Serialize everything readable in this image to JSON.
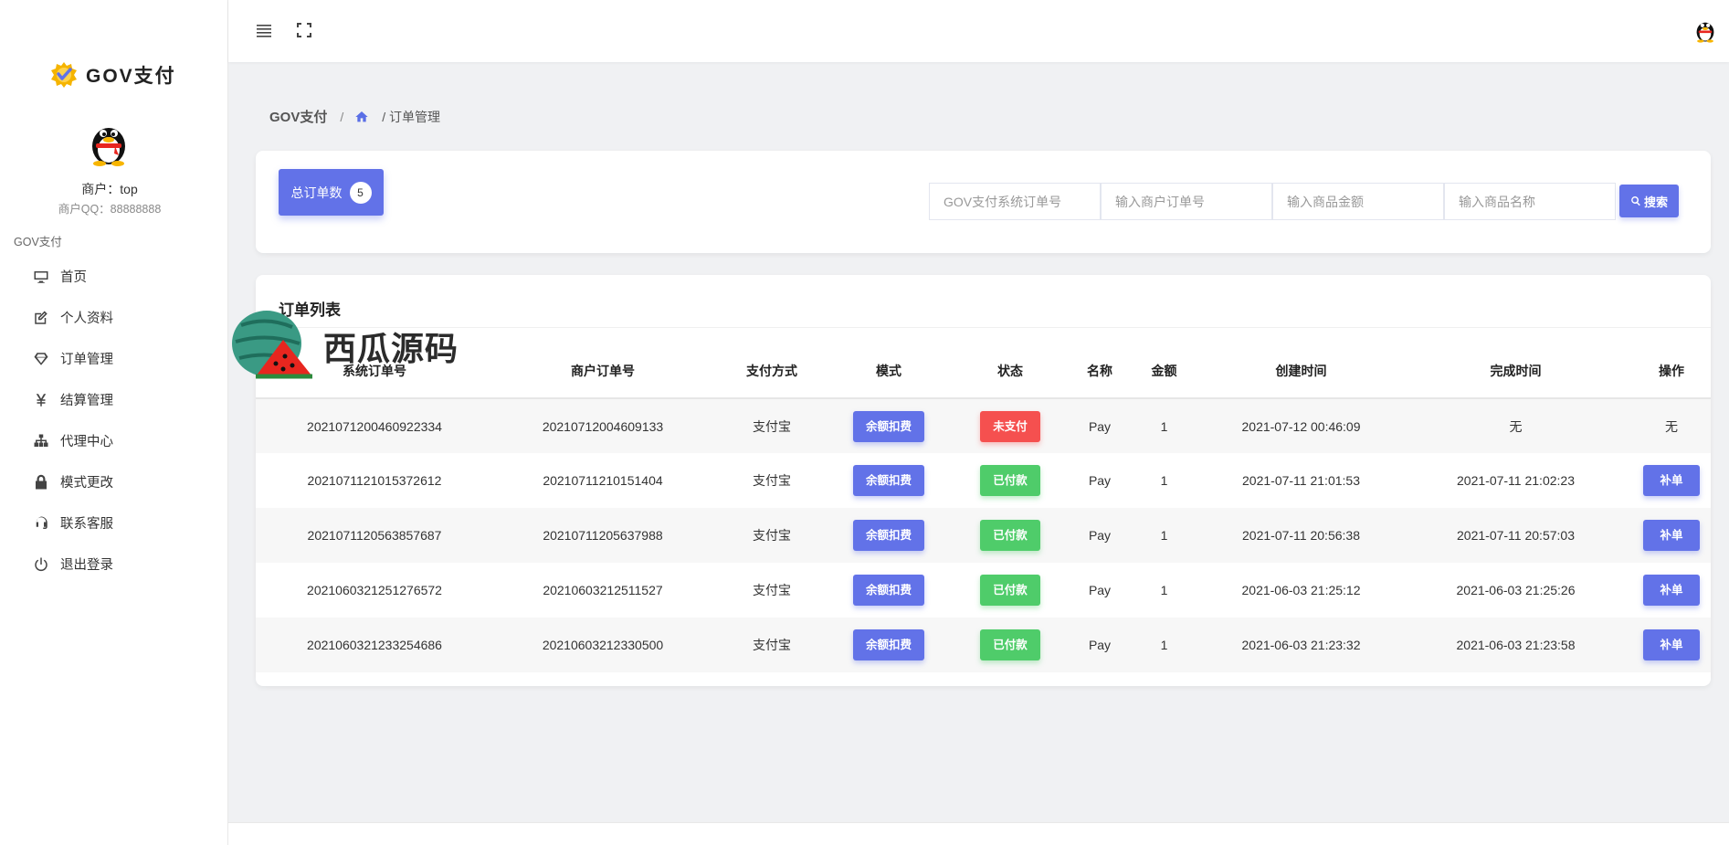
{
  "brand": {
    "name": "GOV支付"
  },
  "merchant": {
    "name": "商户：top",
    "qq": "商户QQ：88888888"
  },
  "sidebar": {
    "section_label": "GOV支付",
    "items": [
      {
        "label": "首页",
        "icon": "monitor-icon"
      },
      {
        "label": "个人资料",
        "icon": "edit-icon"
      },
      {
        "label": "订单管理",
        "icon": "diamond-icon"
      },
      {
        "label": "结算管理",
        "icon": "yen-icon"
      },
      {
        "label": "代理中心",
        "icon": "sitemap-icon"
      },
      {
        "label": "模式更改",
        "icon": "lock-icon"
      },
      {
        "label": "联系客服",
        "icon": "headset-icon"
      },
      {
        "label": "退出登录",
        "icon": "power-icon"
      }
    ]
  },
  "breadcrumb": {
    "root": "GOV支付",
    "sep": "/",
    "current": "/ 订单管理"
  },
  "filters": {
    "total_label": "总订单数",
    "total_count": "5",
    "system_order_placeholder": "GOV支付系统订单号",
    "merchant_order_placeholder": "输入商户订单号",
    "amount_placeholder": "输入商品金额",
    "product_name_placeholder": "输入商品名称",
    "search_label": "搜索"
  },
  "table": {
    "title": "订单列表",
    "columns": [
      "系统订单号",
      "商户订单号",
      "支付方式",
      "模式",
      "状态",
      "名称",
      "金额",
      "创建时间",
      "完成时间",
      "操作"
    ],
    "rows": [
      {
        "system_no": "2021071200460922334",
        "merchant_no": "20210712004609133",
        "method": "支付宝",
        "mode": "余额扣费",
        "status": "未支付",
        "status_color": "#f5504f",
        "name": "Pay",
        "amount": "1",
        "created": "2021-07-12 00:46:09",
        "finished": "无",
        "action": "无"
      },
      {
        "system_no": "2021071121015372612",
        "merchant_no": "20210711210151404",
        "method": "支付宝",
        "mode": "余额扣费",
        "status": "已付款",
        "status_color": "#4fcc6a",
        "name": "Pay",
        "amount": "1",
        "created": "2021-07-11 21:01:53",
        "finished": "2021-07-11 21:02:23",
        "action": "补单"
      },
      {
        "system_no": "2021071120563857687",
        "merchant_no": "20210711205637988",
        "method": "支付宝",
        "mode": "余额扣费",
        "status": "已付款",
        "status_color": "#4fcc6a",
        "name": "Pay",
        "amount": "1",
        "created": "2021-07-11 20:56:38",
        "finished": "2021-07-11 20:57:03",
        "action": "补单"
      },
      {
        "system_no": "2021060321251276572",
        "merchant_no": "20210603212511527",
        "method": "支付宝",
        "mode": "余额扣费",
        "status": "已付款",
        "status_color": "#4fcc6a",
        "name": "Pay",
        "amount": "1",
        "created": "2021-06-03 21:25:12",
        "finished": "2021-06-03 21:25:26",
        "action": "补单"
      },
      {
        "system_no": "2021060321233254686",
        "merchant_no": "20210603212330500",
        "method": "支付宝",
        "mode": "余额扣费",
        "status": "已付款",
        "status_color": "#4fcc6a",
        "name": "Pay",
        "amount": "1",
        "created": "2021-06-03 21:23:32",
        "finished": "2021-06-03 21:23:58",
        "action": "补单"
      }
    ]
  },
  "watermark": {
    "text": "西瓜源码"
  },
  "colors": {
    "primary": "#6272e8",
    "danger": "#f5504f",
    "success": "#4fcc6a"
  }
}
